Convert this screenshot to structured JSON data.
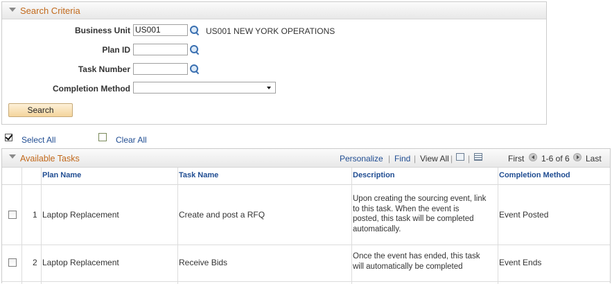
{
  "search_criteria": {
    "title": "Search Criteria",
    "business_unit_label": "Business Unit",
    "business_unit_value": "US001",
    "business_unit_description": "US001 NEW YORK OPERATIONS",
    "plan_id_label": "Plan ID",
    "plan_id_value": "",
    "task_number_label": "Task Number",
    "task_number_value": "",
    "completion_method_label": "Completion Method",
    "completion_method_value": "",
    "search_button": "Search"
  },
  "select_all_label": "Select All",
  "clear_all_label": "Clear All",
  "tasks_grid": {
    "title": "Available Tasks",
    "toolbar": {
      "personalize": "Personalize",
      "find": "Find",
      "view_all": "View All",
      "first": "First",
      "range": "1-6 of 6",
      "last": "Last"
    },
    "columns": [
      "Plan Name",
      "Task Name",
      "Description",
      "Completion Method"
    ],
    "rows": [
      {
        "num": "1",
        "plan_name": "Laptop Replacement",
        "task_name": "Create and post a RFQ",
        "description": [
          "Upon creating the sourcing event, link",
          "to this task.  When the event is",
          "posted, this task will be completed",
          "automatically."
        ],
        "completion_method": "Event Posted"
      },
      {
        "num": "2",
        "plan_name": "Laptop Replacement",
        "task_name": "Receive Bids",
        "description": [
          "Once the event has ended, this task",
          "will automatically be completed"
        ],
        "completion_method": "Event Ends"
      }
    ]
  },
  "icons": {
    "collapse": "collapse-triangle-icon",
    "lookup": "lookup-magnifier-icon",
    "zoom": "zoom-icon",
    "download": "download-grid-icon",
    "prev": "previous-icon",
    "next": "next-icon"
  },
  "colors": {
    "section_title": "#c2691b",
    "link": "#204d92"
  }
}
